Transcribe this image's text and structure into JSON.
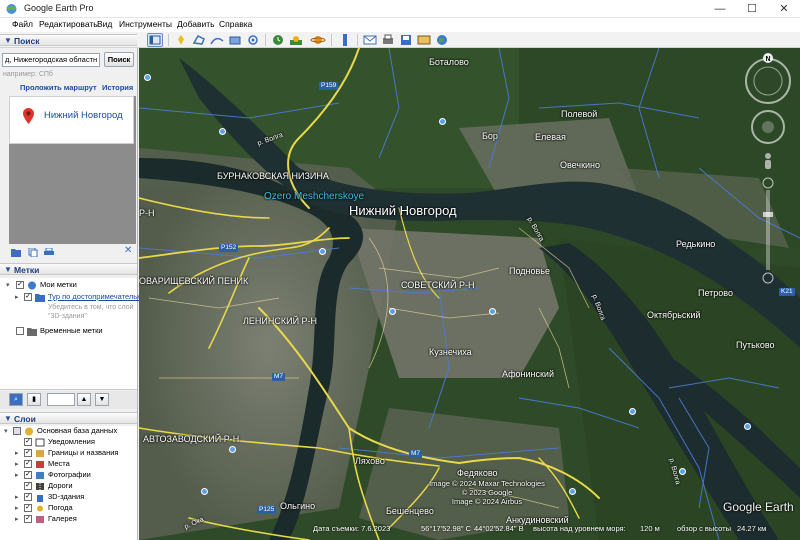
{
  "window": {
    "title": "Google Earth Pro",
    "minimize": "—",
    "maximize": "☐",
    "close": "✕"
  },
  "menu": [
    "Файл",
    "Редактировать",
    "Вид",
    "Инструменты",
    "Добавить",
    "Справка"
  ],
  "search": {
    "header": "Поиск",
    "input_value": "д, Нижегородская областн",
    "button": "Поиск",
    "example": "например: СПб",
    "route_link": "Проложить маршрут",
    "history_link": "История",
    "result_name": "Нижний Новгород"
  },
  "places": {
    "header": "Метки",
    "my_places": "Мои метки",
    "tour_link": "Тур по достопримечательн",
    "tour_desc": "Убедитесь в том, что слой \"3D-здания\"",
    "temp_places": "Временные метки"
  },
  "layers": {
    "header": "Слои",
    "items": [
      "Основная база данных",
      "Уведомления",
      "Границы и названия",
      "Места",
      "Фотографии",
      "Дороги",
      "3D-здания",
      "Погода",
      "Галерея"
    ]
  },
  "map_labels": {
    "cities": [
      "Нижний Новгород"
    ],
    "places": [
      "Боталово",
      "Полевой",
      "Бор",
      "Елевая",
      "Овечкино",
      "Редькино",
      "Петрово",
      "Октябрьский",
      "Путьково",
      "Подновье",
      "Кузнечиха",
      "Афонинский",
      "Ляхово",
      "Федяково",
      "Бешенцево",
      "Ольгино",
      "Анкудиновский"
    ],
    "districts": [
      "БУРНАКОВСКАЯ НИЗИНА",
      "ОВАРИЩЕВСКИЙ ПЕНИК",
      "ЛЕНИНСКИЙ Р-Н",
      "СОВЕТСКИЙ Р-Н",
      "АВТОЗАВОДСКИЙ Р-Н",
      "Р-Н"
    ],
    "lake": "Ozero Meshcherskoye",
    "rivers": [
      "р. Волга",
      "р. Волга",
      "р. Ока",
      "р. Волга",
      "р. Волга"
    ],
    "roads": [
      "P159",
      "P152",
      "M7",
      "M7",
      "P125",
      "K21"
    ]
  },
  "attribution": [
    "Image © 2024 Maxar Technologies",
    "© 2023 Google",
    "Image © 2024 Airbus"
  ],
  "logo": "Google Earth",
  "status": {
    "date": "Дата съемки: 7.6.2023",
    "lat": "56°17'52.98\" С",
    "lon": "44°02'52.84\" В",
    "elevation": "высота над уровнем моря:",
    "elevation_value": "120 м",
    "eye_alt": "обзор с высоты",
    "eye_alt_value": "24.27 км"
  },
  "nav": {
    "north": "N"
  },
  "colors": {
    "road_yellow": "#e8d84a",
    "boundary_blue": "#4a7cd6",
    "river": "#1e2e30",
    "forest": "#2a4a22",
    "urban": "#7d7f78"
  }
}
